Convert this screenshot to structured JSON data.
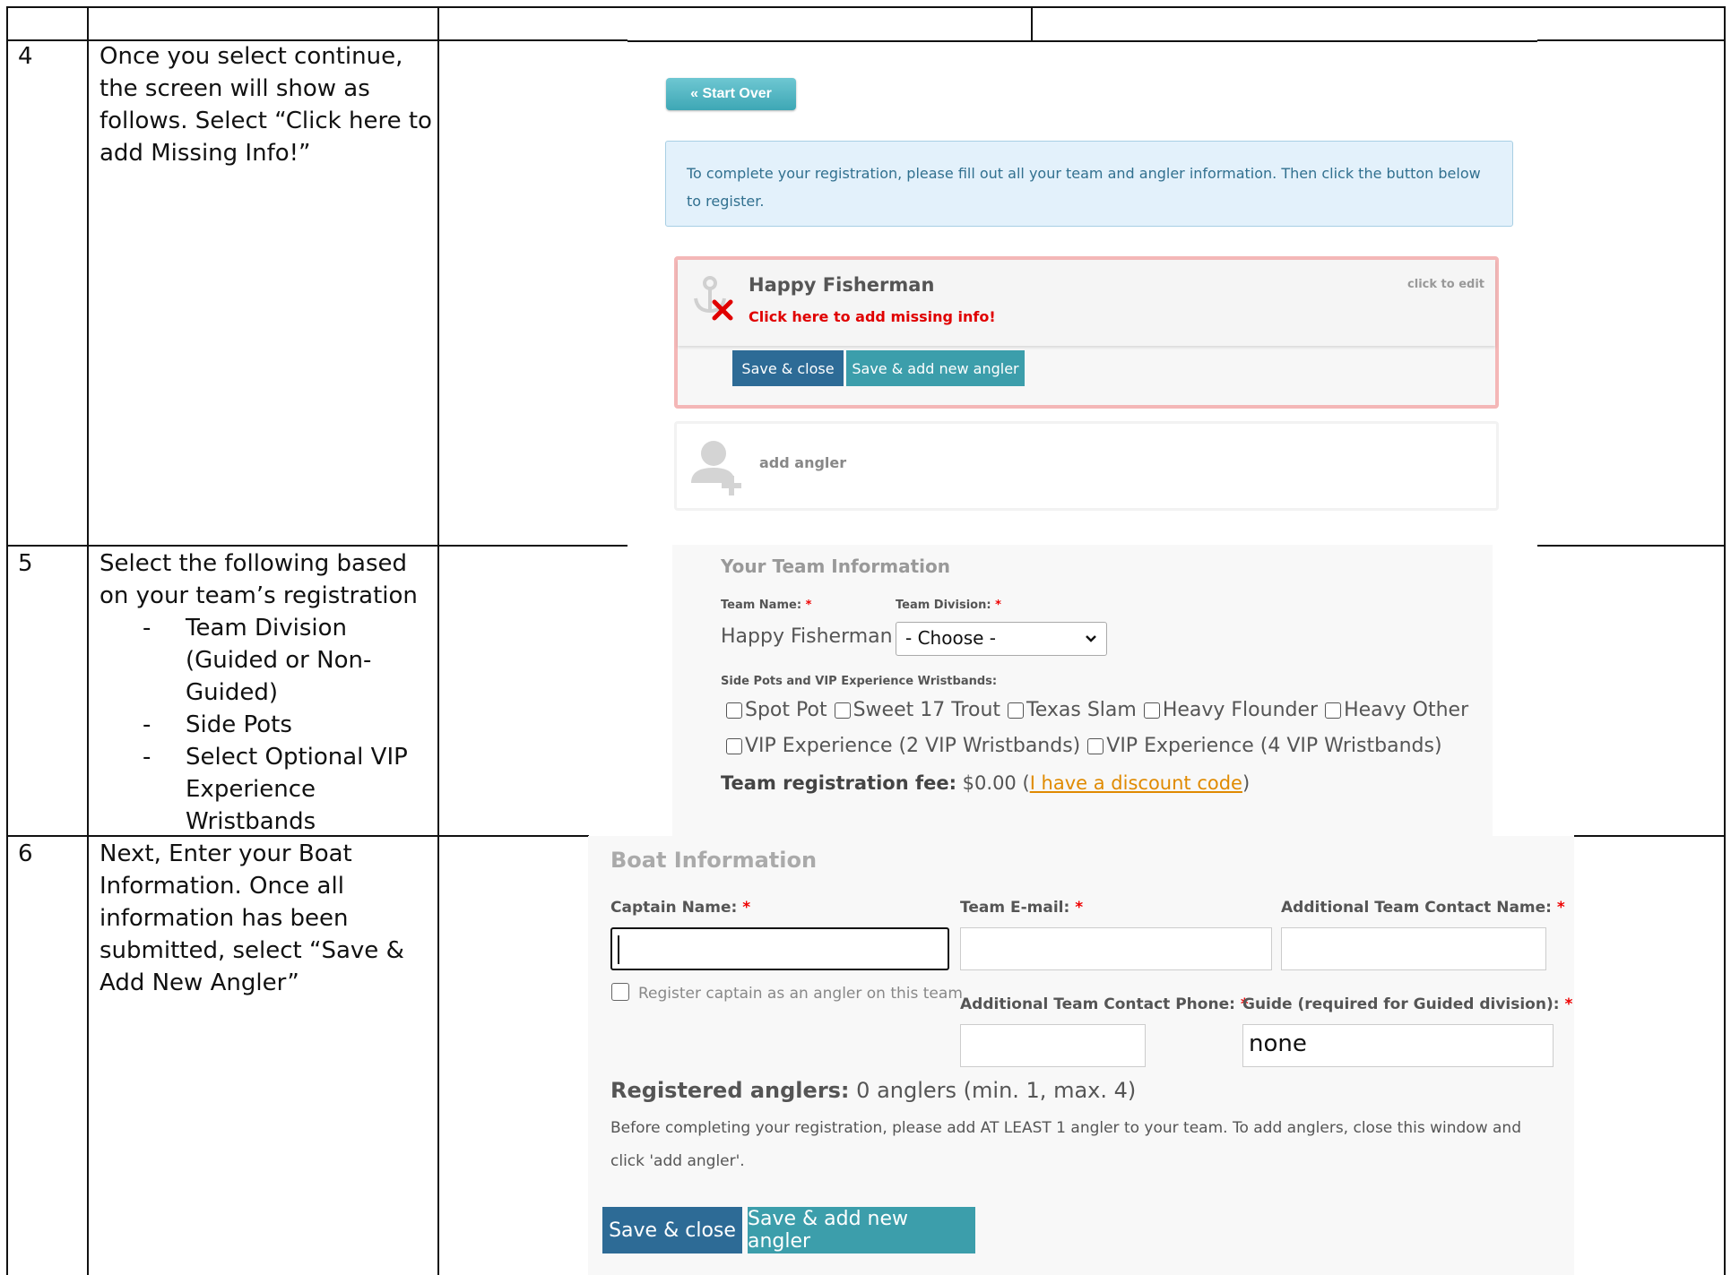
{
  "steps": [
    {
      "number": "4",
      "text": "Once you select continue, the screen will show as follows. Select “Click here to add Missing Info!”"
    },
    {
      "number": "5",
      "intro": "Select the following based on your team’s registration",
      "bullets": [
        "Team Division (Guided or Non-Guided)",
        "Side Pots",
        "Select Optional VIP Experience Wristbands"
      ]
    },
    {
      "number": "6",
      "text": "Next, Enter your Boat Information. Once all information has been submitted, select “Save & Add New Angler”"
    }
  ],
  "registration_screen": {
    "start_over": "« Start Over",
    "info_message": "To complete your registration, please fill out all your team and angler information. Then click the button below to register.",
    "angler_card": {
      "name": "Happy Fisherman",
      "missing_info": "Click here to add missing info!",
      "edit_hint": "click to edit",
      "save_close": "Save & close",
      "save_add": "Save & add new angler"
    },
    "add_angler": "add angler"
  },
  "team_info": {
    "title": "Your Team Information",
    "team_name_label": "Team Name:",
    "team_division_label": "Team Division:",
    "required_mark": "*",
    "team_name_value": "Happy Fisherman",
    "division_selected": "- Choose -",
    "side_pots_label": "Side Pots and VIP Experience Wristbands:",
    "options_row1": [
      "Spot Pot",
      "Sweet 17 Trout",
      "Texas Slam",
      "Heavy Flounder",
      "Heavy Other"
    ],
    "options_row2": [
      "VIP Experience (2 VIP Wristbands)",
      "VIP Experience (4 VIP Wristbands)"
    ],
    "fee_label": "Team registration fee:",
    "fee_value": "$0.00",
    "fee_paren_open": "(",
    "discount_link": "I have a discount code",
    "fee_paren_close": ")"
  },
  "boat_info": {
    "title": "Boat Information",
    "captain_label": "Captain Name:",
    "email_label": "Team E-mail:",
    "contact_name_label": "Additional Team Contact Name:",
    "register_captain": "Register captain as an angler on this team",
    "contact_phone_label": "Additional Team Contact Phone:",
    "guide_label": "Guide (required for Guided division):",
    "guide_value": "none",
    "registered_label": "Registered anglers:",
    "registered_value": "0 anglers (min. 1, max. 4)",
    "note": "Before completing your registration, please add AT LEAST 1 angler to your team. To add anglers, close this window and click 'add angler'.",
    "save_close": "Save & close",
    "save_add": "Save & add new angler"
  }
}
